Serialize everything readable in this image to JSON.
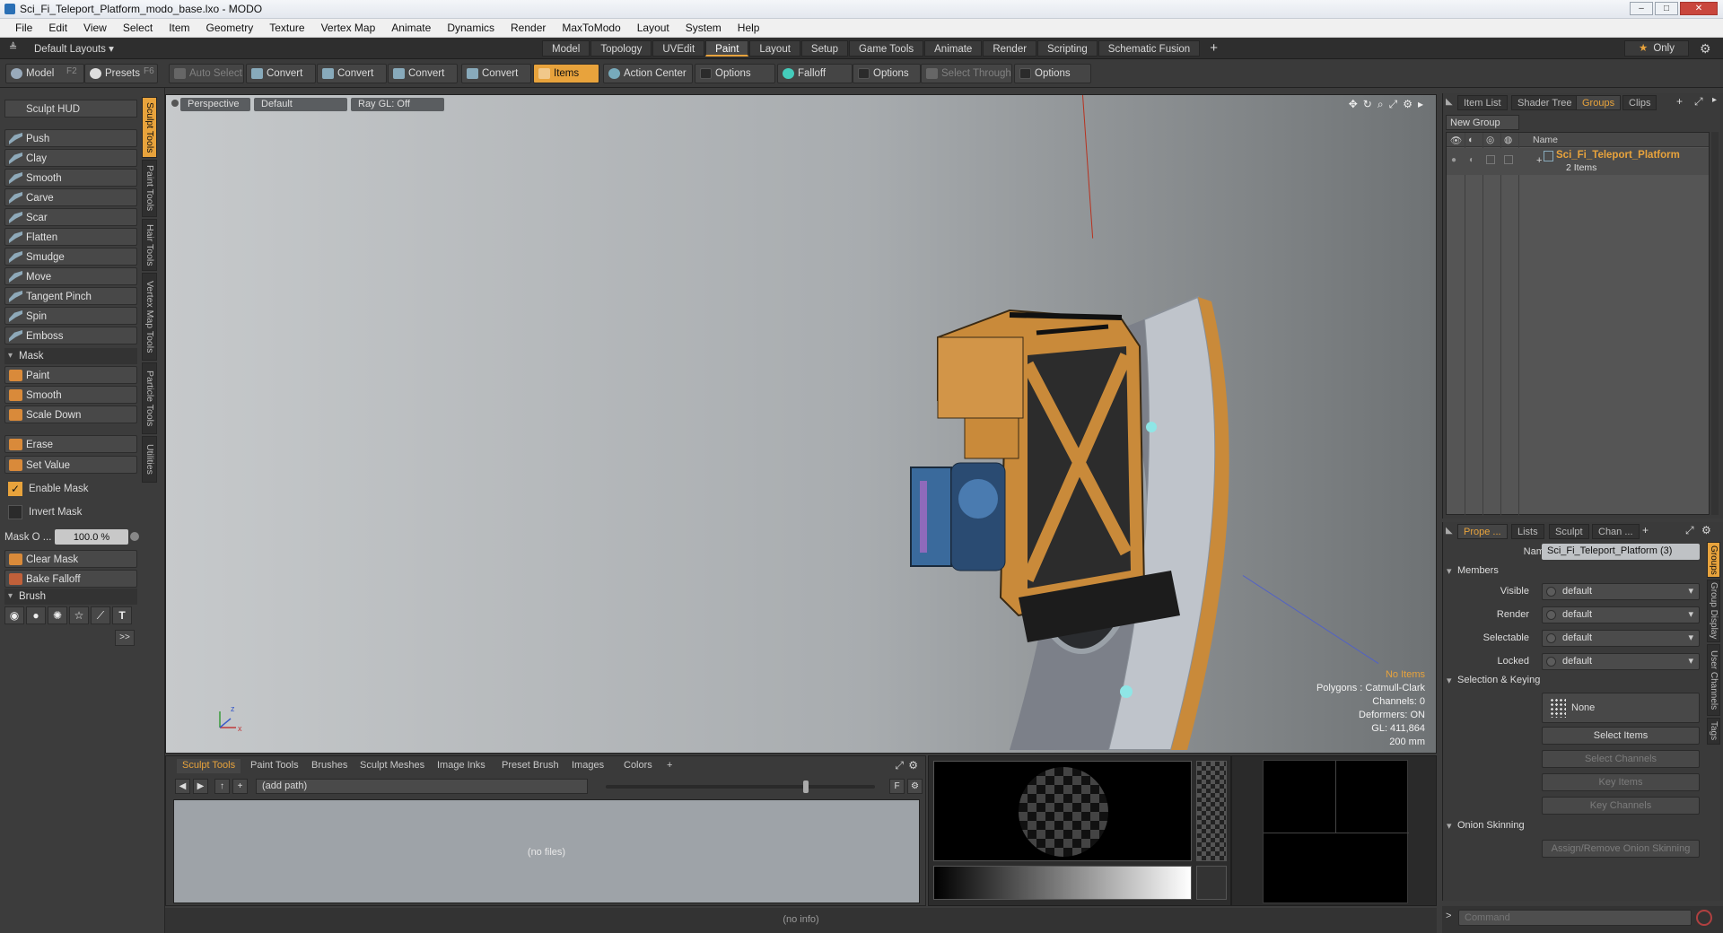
{
  "window": {
    "title": "Sci_Fi_Teleport_Platform_modo_base.lxo - MODO"
  },
  "menu": [
    "File",
    "Edit",
    "View",
    "Select",
    "Item",
    "Geometry",
    "Texture",
    "Vertex Map",
    "Animate",
    "Dynamics",
    "Render",
    "MaxToModo",
    "Layout",
    "System",
    "Help"
  ],
  "layout_bar": {
    "default_layouts": "Default Layouts ▾",
    "tabs": [
      "Model",
      "Topology",
      "UVEdit",
      "Paint",
      "Layout",
      "Setup",
      "Game Tools",
      "Animate",
      "Render",
      "Scripting",
      "Schematic Fusion"
    ],
    "active_tab": "Paint",
    "only_label": "Only"
  },
  "toolbar": {
    "model": "Model",
    "model_key": "F2",
    "presets": "Presets",
    "presets_key": "F6",
    "auto_select": "Auto Select",
    "convert": "Convert",
    "items": "Items",
    "action_center": "Action Center",
    "options": "Options",
    "falloff": "Falloff",
    "select_through": "Select Through"
  },
  "left_panel": {
    "sculpt_hud": "Sculpt HUD",
    "tools": [
      "Push",
      "Clay",
      "Smooth",
      "Carve",
      "Scar",
      "Flatten",
      "Smudge",
      "Move",
      "Tangent Pinch",
      "Spin",
      "Emboss"
    ],
    "mask_section": "Mask",
    "mask_tools": [
      "Paint",
      "Smooth",
      "Scale Down"
    ],
    "erase": "Erase",
    "set_value": "Set Value",
    "enable_mask": "Enable Mask",
    "invert_mask": "Invert Mask",
    "mask_opacity_label": "Mask O ...",
    "mask_opacity_value": "100.0 %",
    "clear_mask": "Clear Mask",
    "bake_falloff": "Bake Falloff",
    "brush_section": "Brush",
    "more": ">>",
    "side_tabs": [
      "Sculpt Tools",
      "Paint Tools",
      "Hair Tools",
      "Vertex Map Tools",
      "Particle Tools",
      "Utilities"
    ]
  },
  "viewport": {
    "tabs": [
      "Perspective",
      "Default",
      "Ray GL: Off"
    ],
    "info": {
      "items": "No Items",
      "polygons": "Polygons : Catmull-Clark",
      "channels": "Channels: 0",
      "deformers": "Deformers: ON",
      "gl": "GL: 411,864",
      "scale": "200 mm"
    }
  },
  "bottom_panel": {
    "tabs": [
      "Sculpt Tools",
      "Paint Tools",
      "Brushes",
      "Sculpt Meshes",
      "Image Inks",
      "Preset Brush",
      "Images",
      "Colors"
    ],
    "path_placeholder": "(add path)",
    "empty_text": "(no files)",
    "f_label": "F"
  },
  "status": {
    "text": "(no info)"
  },
  "right_top": {
    "tabs": [
      "Item List",
      "Shader Tree",
      "Groups",
      "Clips"
    ],
    "active_tab": "Groups",
    "new_group": "New Group",
    "column_name": "Name",
    "group_name": "Sci_Fi_Teleport_Platform",
    "group_count": "2 Items"
  },
  "right_bottom": {
    "tabs": [
      "Prope ...",
      "Lists",
      "Sculpt",
      "Chan ..."
    ],
    "name_label": "Name",
    "name_value": "Sci_Fi_Teleport_Platform (3)",
    "members_section": "Members",
    "visible_label": "Visible",
    "visible_value": "default",
    "render_label": "Render",
    "render_value": "default",
    "selectable_label": "Selectable",
    "selectable_value": "default",
    "locked_label": "Locked",
    "locked_value": "default",
    "selection_section": "Selection & Keying",
    "none_label": "None",
    "select_items": "Select Items",
    "select_channels": "Select Channels",
    "key_items": "Key Items",
    "key_channels": "Key Channels",
    "onion_section": "Onion Skinning",
    "onion_button": "Assign/Remove Onion Skinning",
    "side_tabs": [
      "Groups",
      "Group Display",
      "User Channels",
      "Tags"
    ]
  },
  "command": {
    "placeholder": "Command",
    "prompt": ">"
  },
  "colors": {
    "accent": "#e8a33c",
    "viewport_bg": "#a8acaf",
    "model_orange": "#c98a3a"
  }
}
